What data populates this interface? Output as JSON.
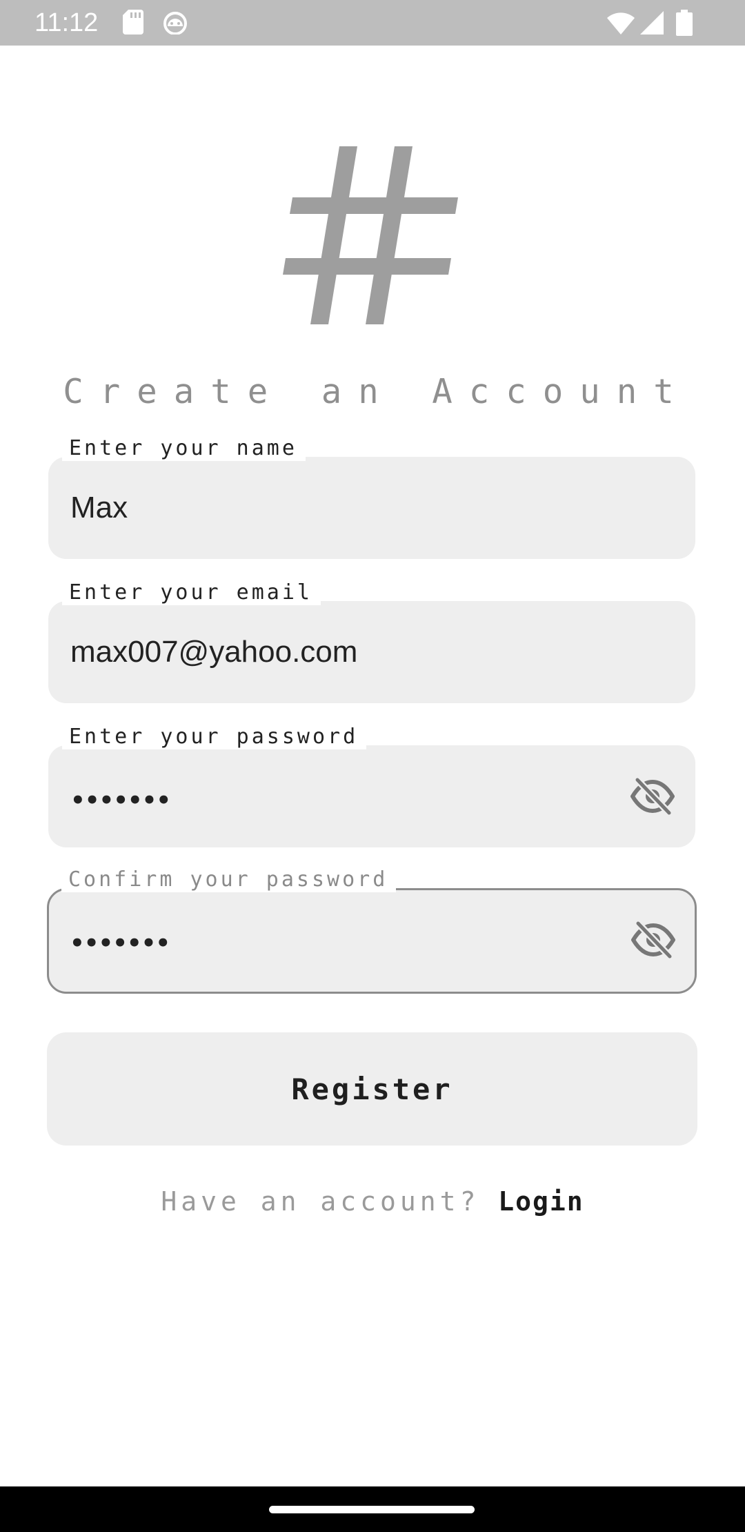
{
  "status_bar": {
    "time": "11:12",
    "left_icons": [
      "sd-card-icon",
      "android-debug-icon"
    ],
    "right_icons": [
      "wifi-icon",
      "signal-icon",
      "battery-icon"
    ]
  },
  "logo": {
    "icon": "hash-icon",
    "color": "#9e9e9e"
  },
  "title": "Create an Account",
  "fields": {
    "name": {
      "label": "Enter your name",
      "value": "Max"
    },
    "email": {
      "label": "Enter your email",
      "value": "max007@yahoo.com"
    },
    "password": {
      "label": "Enter your password",
      "value": "•••••••",
      "toggle_icon": "eye-off-icon"
    },
    "confirm_password": {
      "label": "Confirm your password",
      "value": "•••••••",
      "toggle_icon": "eye-off-icon",
      "focused": true
    }
  },
  "register_button": {
    "label": "Register"
  },
  "login_row": {
    "prompt": "Have an account?",
    "link": "Login"
  },
  "colors": {
    "field_background": "#eeeeee",
    "status_bar": "#bdbdbd",
    "text_primary": "#222222",
    "text_muted": "#9a9a9a"
  }
}
